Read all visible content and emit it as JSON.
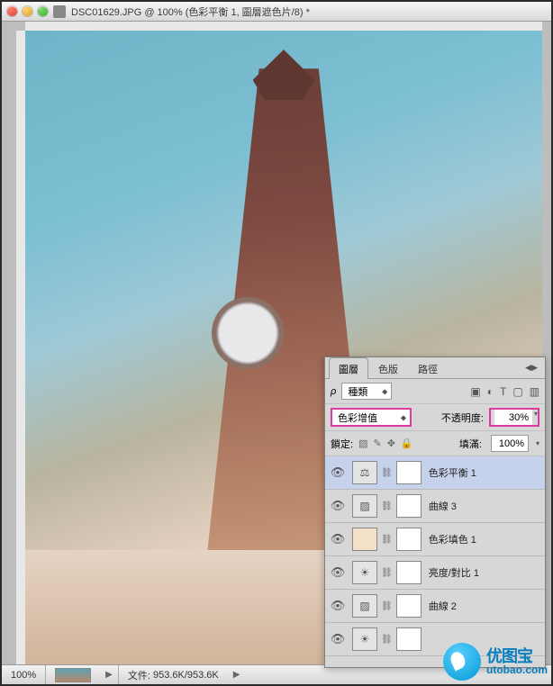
{
  "window": {
    "title": "DSC01629.JPG @ 100% (色彩平衡 1, 圖層遮色片/8) *"
  },
  "status": {
    "zoom": "100%",
    "file_label": "文件:",
    "file_size": "953.6K/953.6K"
  },
  "panel": {
    "tabs": [
      "圖層",
      "色版",
      "路徑"
    ],
    "active_tab": 0,
    "filter_label": "種類",
    "filter_glyph": "ρ",
    "blend_mode": "色彩增值",
    "opacity_label": "不透明度:",
    "opacity_value": "30%",
    "lock_label": "鎖定:",
    "fill_label": "填滿:",
    "fill_value": "100%",
    "layers": [
      {
        "name": "色彩平衡 1",
        "adj_icon": "⚖",
        "selected": true
      },
      {
        "name": "曲線 3",
        "adj_icon": "▨"
      },
      {
        "name": "色彩填色 1",
        "swatch": true
      },
      {
        "name": "亮度/對比 1",
        "adj_icon": "☀"
      },
      {
        "name": "曲線 2",
        "adj_icon": "▨"
      },
      {
        "name": "",
        "adj_icon": "☀"
      }
    ]
  },
  "watermark": {
    "line1": "优图宝",
    "line2": "utobao.com"
  }
}
